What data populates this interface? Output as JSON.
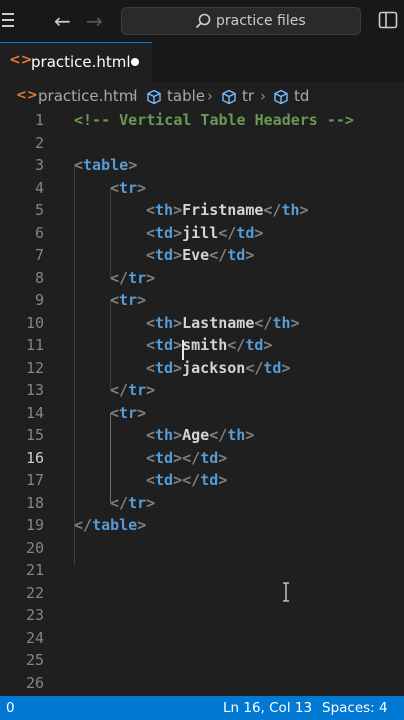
{
  "window": {
    "search_placeholder": "practice files"
  },
  "tab": {
    "filename": "practice.html",
    "icon": "<>",
    "dirty": true
  },
  "breadcrumb": {
    "file": "practice.html",
    "items": [
      "table",
      "tr",
      "td"
    ]
  },
  "editor": {
    "line_numbers": [
      "1",
      "2",
      "3",
      "4",
      "5",
      "6",
      "7",
      "8",
      "9",
      "10",
      "11",
      "12",
      "13",
      "14",
      "15",
      "16",
      "17",
      "18",
      "19",
      "20",
      "21",
      "22",
      "23",
      "24",
      "25",
      "26"
    ],
    "current_line": "16",
    "lines": [
      {
        "n": 1,
        "comment": "<!-- Vertical Table Headers -->"
      },
      {
        "n": 3,
        "open": "<",
        "tag": "table",
        "close": ">"
      },
      {
        "n": 4,
        "open": "<",
        "tag": "tr",
        "close": ">"
      },
      {
        "n": 5,
        "tag": "th",
        "text": "Fristname"
      },
      {
        "n": 6,
        "tag": "td",
        "text": "jill"
      },
      {
        "n": 7,
        "tag": "td",
        "text": "Eve"
      },
      {
        "n": 8,
        "open": "</",
        "tag": "tr",
        "close": ">"
      },
      {
        "n": 9,
        "open": "<",
        "tag": "tr",
        "close": ">"
      },
      {
        "n": 10,
        "tag": "th",
        "text": "Lastname"
      },
      {
        "n": 11,
        "tag": "td",
        "text": "smith"
      },
      {
        "n": 12,
        "tag": "td",
        "text": "jackson"
      },
      {
        "n": 13,
        "open": "</",
        "tag": "tr",
        "close": ">"
      },
      {
        "n": 14,
        "open": "<",
        "tag": "tr",
        "close": ">"
      },
      {
        "n": 15,
        "tag": "th",
        "text": "Age"
      },
      {
        "n": 16,
        "tag": "td",
        "text": ""
      },
      {
        "n": 17,
        "tag": "td",
        "text": ""
      },
      {
        "n": 18,
        "open": "</",
        "tag": "tr",
        "close": ">"
      },
      {
        "n": 19,
        "open": "</",
        "tag": "table",
        "close": ">"
      }
    ]
  },
  "status": {
    "left": "0",
    "position": "Ln 16, Col 13",
    "spaces": "Spaces: 4",
    "color": "#0078d4"
  }
}
